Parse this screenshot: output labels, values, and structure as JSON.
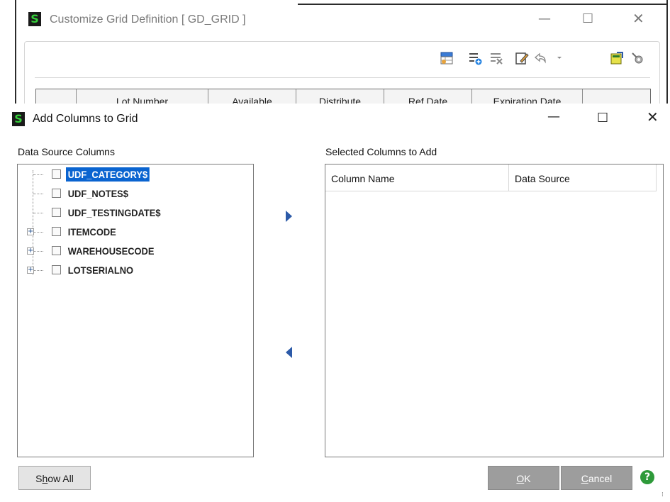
{
  "background_window": {
    "title": "Customize Grid Definition [ GD_GRID ]",
    "logo_letter": "S",
    "min_glyph": "—",
    "max_glyph": "☐",
    "close_glyph": "✕",
    "toolbar_icons": [
      "grid-properties-icon",
      "add-column-icon",
      "delete-column-icon",
      "edit-icon",
      "undo-icon",
      "undo-dropdown-icon",
      "import-icon",
      "settings-icon"
    ],
    "grid_columns": [
      "",
      "Lot Number",
      "Available",
      "Distribute",
      "Ref Date",
      "Expiration Date",
      ""
    ]
  },
  "dialog": {
    "title": "Add Columns to Grid",
    "logo_letter": "S",
    "min_glyph": "—",
    "max_glyph": "☐",
    "close_glyph": "✕",
    "source_label": "Data Source Columns",
    "selected_label": "Selected Columns to Add",
    "tree_items": [
      {
        "label": "UDF_CATEGORY$",
        "expandable": false,
        "selected": true,
        "checked": false
      },
      {
        "label": "UDF_NOTES$",
        "expandable": false,
        "selected": false,
        "checked": false
      },
      {
        "label": "UDF_TESTINGDATE$",
        "expandable": false,
        "selected": false,
        "checked": false
      },
      {
        "label": "ITEMCODE",
        "expandable": true,
        "selected": false,
        "checked": false
      },
      {
        "label": "WAREHOUSECODE",
        "expandable": true,
        "selected": false,
        "checked": false
      },
      {
        "label": "LOTSERIALNO",
        "expandable": true,
        "selected": false,
        "checked": false
      }
    ],
    "expander_glyph": "+",
    "selected_columns": {
      "headers": [
        "Column Name",
        "Data Source"
      ],
      "rows": []
    },
    "buttons": {
      "show_all_pre": "S",
      "show_all_ul": "h",
      "show_all_post": "ow All",
      "ok_ul": "O",
      "ok_post": "K",
      "cancel_ul": "C",
      "cancel_post": "ancel"
    },
    "help_glyph": "?",
    "grip_glyph": "⁞"
  },
  "colors": {
    "selection": "#0a64d0",
    "arrow": "#2c5aa8",
    "logo_bg": "#1a1a1a",
    "logo_fg": "#35d13a",
    "help": "#2e9a3a",
    "disabled_button": "#9d9d9d"
  }
}
